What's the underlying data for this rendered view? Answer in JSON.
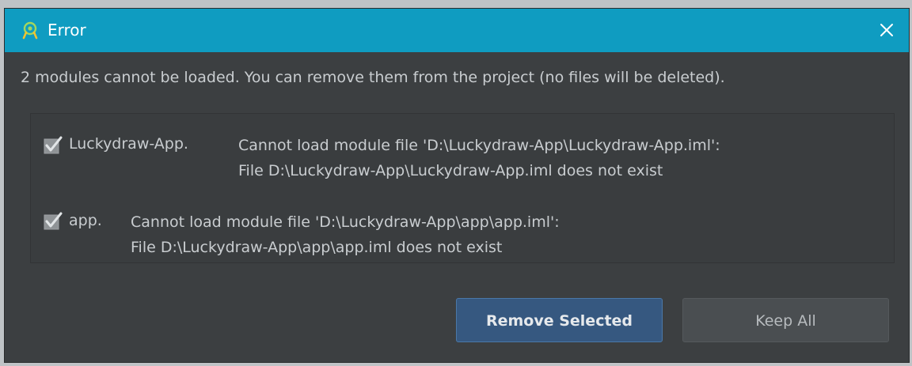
{
  "window": {
    "title": "Error",
    "icon": "android-studio-icon",
    "close_icon": "close-icon"
  },
  "message": "2 modules cannot be loaded. You can remove them from the project (no files will be deleted).",
  "modules": [
    {
      "checked": true,
      "name": "Luckydraw-App.",
      "line1": "Cannot load module file 'D:\\Luckydraw-App\\Luckydraw-App.iml':",
      "line2": "File D:\\Luckydraw-App\\Luckydraw-App.iml does not exist"
    },
    {
      "checked": true,
      "name": "app.",
      "line1": "Cannot load module file 'D:\\Luckydraw-App\\app\\app.iml':",
      "line2": "File D:\\Luckydraw-App\\app\\app.iml does not exist"
    }
  ],
  "buttons": {
    "remove_selected": "Remove Selected",
    "keep_all": "Keep All"
  },
  "colors": {
    "titlebar": "#0f9cc1",
    "background": "#3c3f41",
    "text": "#c9cdd0",
    "primary_button": "#365880",
    "secondary_button": "#4a4e51"
  }
}
